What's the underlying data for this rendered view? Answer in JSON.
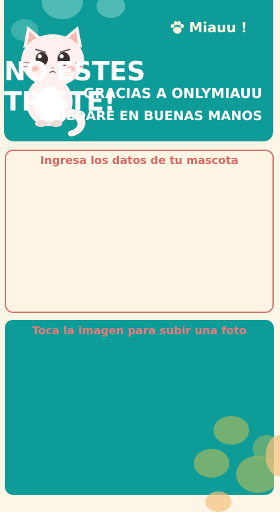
{
  "banner": {
    "brand": "Miauu !",
    "title": "NO ESTES TRISTE!",
    "subtitle_1": "GRACIAS A ONLYMIAUU",
    "subtitle_2": "QUEDARÉ EN BUENAS MANOS",
    "brand_icon": "paw-icon",
    "mascot": "sad-cat-illustration"
  },
  "form": {
    "heading": "Ingresa los datos de tu mascota"
  },
  "photo": {
    "heading": "Toca la imagen para subir una foto"
  },
  "colors": {
    "teal": "#0e9c99",
    "cream": "#fdf6e6",
    "coral": "#d9726d",
    "green_paw": "#80b36e"
  }
}
